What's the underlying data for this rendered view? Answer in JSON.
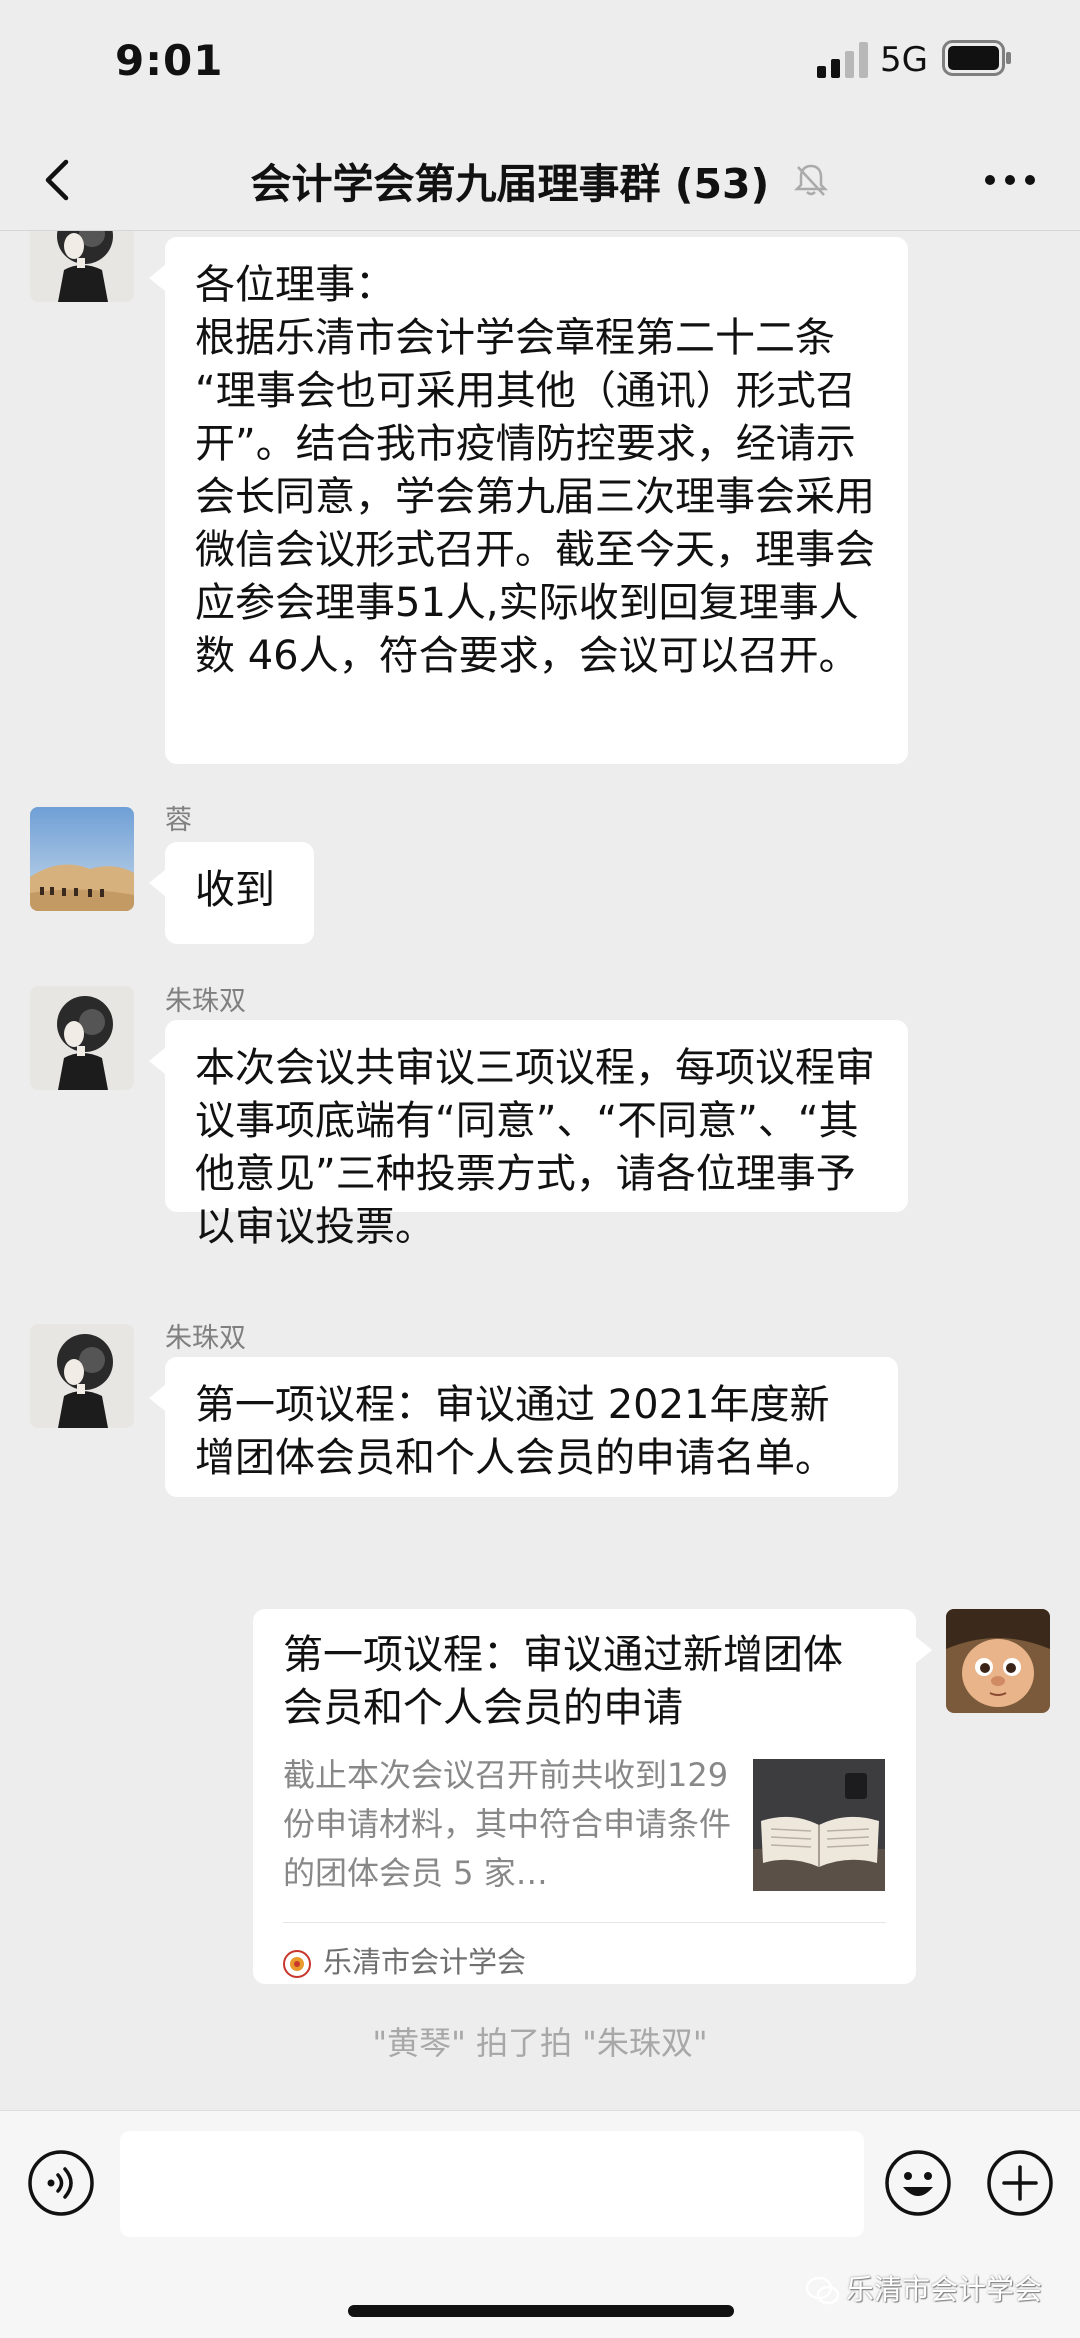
{
  "status_bar": {
    "time": "9:01",
    "network": "5G"
  },
  "nav": {
    "title": "会计学会第九届理事群 (53)"
  },
  "messages": {
    "m1": {
      "text": "各位理事：\n根据乐清市会计学会章程第二十二条 “理事会也可采用其他（通讯）形式召开”。结合我市疫情防控要求，经请示会长同意，学会第九届三次理事会采用微信会议形式召开。截至今天，理事会应参会理事51人,实际收到回复理事人数 46人，符合要求，会议可以召开。"
    },
    "m2": {
      "sender": "蓉",
      "text": "收到"
    },
    "m3": {
      "sender": "朱珠双",
      "text": "本次会议共审议三项议程，每项议程审议事项底端有“同意”、“不同意”、“其他意见”三种投票方式，请各位理事予以审议投票。"
    },
    "m4": {
      "sender": "朱珠双",
      "text": "第一项议程：审议通过 2021年度新增团体会员和个人会员的申请名单。"
    },
    "m5": {
      "title": "第一项议程：审议通过新增团体会员和个人会员的申请",
      "description": "截止本次会议召开前共收到129 份申请材料，其中符合申请条件的团体会员 5 家…",
      "source": "乐清市会计学会"
    }
  },
  "system_notice": "\"黄琴\" 拍了拍 \"朱珠双\"",
  "input": {
    "placeholder": ""
  },
  "watermark": "乐清市会计学会"
}
